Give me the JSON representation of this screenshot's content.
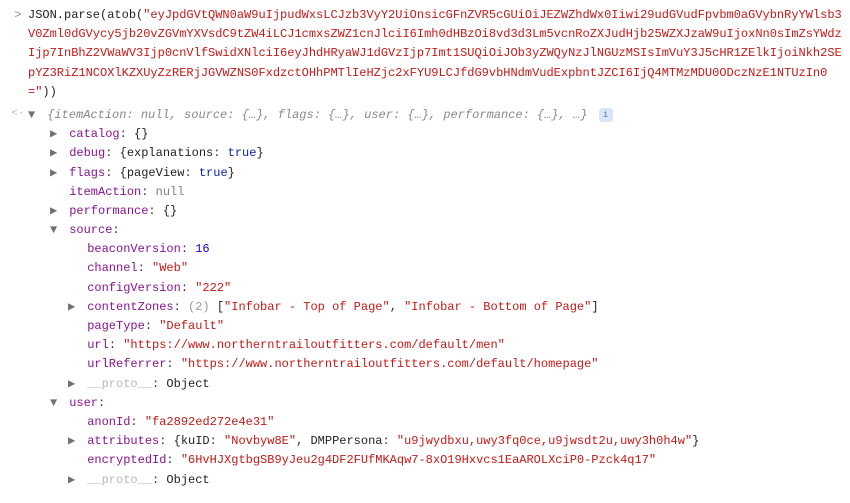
{
  "input": {
    "prefix": "JSON.parse(atob(",
    "arg": "\"eyJpdGVtQWN0aW9uIjpudWxsLCJzb3VyY2UiOnsicGFnZVR5cGUiOiJEZWZhdWx0Iiwi29udGVudFpvbm0aGVybnRyYWlsb3V0Zml0dGVycy5jb20vZGVmYXVsdC9tZW4iLCJ1cmxsZWZ1cnJlciI6Imh0dHBzOi8vd3d3Lm5vcnRoZXJudHjb25WZXJzaW9uIjoxNn0sImZsYWdzIjp7InBhZ2VWaWV3Ijp0cnVlfSwidXNlciI6eyJhdHRyaWJ1dGVzIjp7Imt1SUQiOiJOb3yZWQyNzJlNGUzMSIsImVuY3J5cHR1ZElkIjoiNkh2SEpYZ3RiZ1NCOXlKZXUyZzRERjJGVWZNS0FxdzctOHhPMTlIeHZjc2xFYU9LCJfdG9vbHNdmVudExpbntJZCI6IjQ4MTMzMDU0ODczNzE1NTUzIn0=\"",
    "suffix": "))"
  },
  "output_summary": {
    "open_brace": "{",
    "parts": [
      {
        "k": "itemAction",
        "v": "null"
      },
      {
        "k": "source",
        "v": "{…}"
      },
      {
        "k": "flags",
        "v": "{…}"
      },
      {
        "k": "user",
        "v": "{…}"
      },
      {
        "k": "performance",
        "v": "{…}"
      }
    ],
    "ellipsis": ", …",
    "close_brace": "}"
  },
  "tree": {
    "catalog": {
      "preview": "{}"
    },
    "debug": {
      "preview": "{explanations: true}",
      "explanations_key": "explanations",
      "explanations_val": "true"
    },
    "flags": {
      "preview": "{pageView: true}",
      "pageView_key": "pageView",
      "pageView_val": "true"
    },
    "itemAction": {
      "val": "null"
    },
    "performance": {
      "preview": "{}"
    },
    "source": {
      "beaconVersion": {
        "k": "beaconVersion",
        "v": "16"
      },
      "channel": {
        "k": "channel",
        "v": "\"Web\""
      },
      "configVersion": {
        "k": "configVersion",
        "v": "\"222\""
      },
      "contentZones": {
        "k": "contentZones",
        "count": "(2)",
        "open": "[",
        "v1": "\"Infobar - Top of Page\"",
        "comma": ", ",
        "v2": "\"Infobar - Bottom of Page\"",
        "close": "]"
      },
      "pageType": {
        "k": "pageType",
        "v": "\"Default\""
      },
      "url": {
        "k": "url",
        "v": "\"https://www.northerntrailoutfitters.com/default/men\""
      },
      "urlReferrer": {
        "k": "urlReferrer",
        "v": "\"https://www.northerntrailoutfitters.com/default/homepage\""
      },
      "proto": {
        "k": "__proto__",
        "v": "Object"
      }
    },
    "user": {
      "anonId": {
        "k": "anonId",
        "v": "\"fa2892ed272e4e31\""
      },
      "attributes": {
        "k": "attributes",
        "open": "{",
        "kuID_k": "kuID",
        "kuID_v": "\"Novbyw8E\"",
        "dmp_k": "DMPPersona",
        "dmp_v": "\"u9jwydbxu,uwy3fq0ce,u9jwsdt2u,uwy3h0h4w\"",
        "close": "}"
      },
      "encryptedId": {
        "k": "encryptedId",
        "v": "\"6HvHJXgtbgSB9yJeu2g4DF2FUfMKAqw7-8xO19Hxvcs1EaAROLXciP0-Pzck4q17\""
      },
      "proto": {
        "k": "__proto__",
        "v": "Object"
      }
    }
  },
  "labels": {
    "catalog": "catalog",
    "debug": "debug",
    "flags": "flags",
    "itemAction": "itemAction",
    "performance": "performance",
    "source": "source",
    "user": "user",
    "proto": "__proto__",
    "object": "Object"
  },
  "glyphs": {
    "input_prompt": ">",
    "output_prompt": "<·",
    "collapsed": "▶",
    "expanded": "▼",
    "info": "i"
  }
}
